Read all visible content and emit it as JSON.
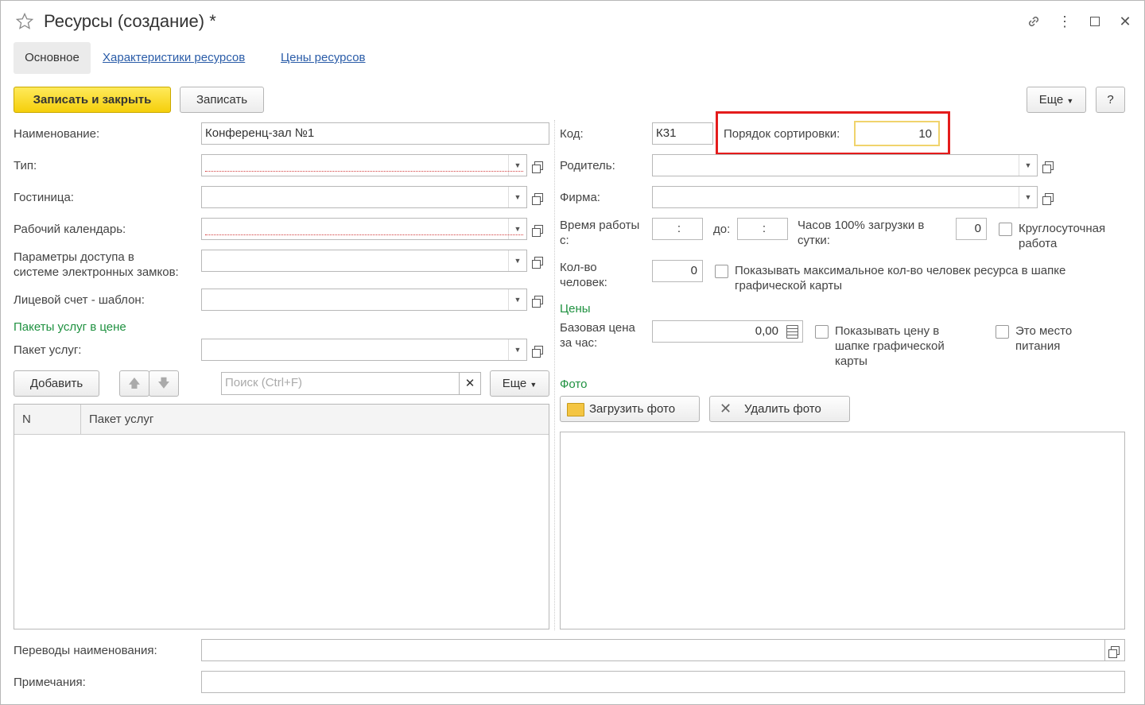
{
  "window": {
    "title": "Ресурсы (создание) *"
  },
  "tabs": [
    {
      "label": "Основное"
    },
    {
      "label": "Характеристики ресурсов"
    },
    {
      "label": "Цены ресурсов"
    }
  ],
  "toolbar": {
    "save_close": "Записать и закрыть",
    "save": "Записать",
    "more": "Еще",
    "help": "?"
  },
  "left": {
    "name_label": "Наименование:",
    "name_value": "Конференц-зал №1",
    "type_label": "Тип:",
    "hotel_label": "Гостиница:",
    "calendar_label": "Рабочий календарь:",
    "access_label_1": "Параметры доступа в",
    "access_label_2": "системе электронных замков:",
    "account_label": "Лицевой счет - шаблон:",
    "packages_group": "Пакеты услуг в цене",
    "package_label": "Пакет услуг:",
    "add_button": "Добавить",
    "search_placeholder": "Поиск (Ctrl+F)",
    "more": "Еще",
    "table_columns": {
      "n": "N",
      "package": "Пакет услуг"
    }
  },
  "right": {
    "code_label": "Код:",
    "code_value": "К31",
    "sort_label": "Порядок сортировки:",
    "sort_value": "10",
    "parent_label": "Родитель:",
    "firm_label": "Фирма:",
    "work_time_label_1": "Время работы",
    "work_time_label_2": "с:",
    "time_from": ":",
    "to_label": "до:",
    "time_to": ":",
    "hours_label_1": "Часов 100% загрузки в",
    "hours_label_2": "сутки:",
    "hours_value": "0",
    "roundclock_1": "Круглосуточная",
    "roundclock_2": "работа",
    "persons_label_1": "Кол-во",
    "persons_label_2": "человек:",
    "persons_value": "0",
    "show_max_1": "Показывать максимальное кол-во человек ресурса в шапке",
    "show_max_2": "графической карты",
    "prices_group": "Цены",
    "base_price_1": "Базовая цена",
    "base_price_2": "за час:",
    "base_price_value": "0,00",
    "show_price_1": "Показывать цену в",
    "show_price_2": "шапке графической",
    "show_price_3": "карты",
    "food_1": "Это место",
    "food_2": "питания",
    "photo_group": "Фото",
    "upload_photo": "Загрузить фото",
    "delete_photo": "Удалить фото"
  },
  "bottom": {
    "translations_label": "Переводы наименования:",
    "notes_label": "Примечания:"
  },
  "colors": {
    "accent_yellow": "#f5cf0b",
    "highlight_red": "#e41c1c",
    "group_green": "#1f9140",
    "link_blue": "#2a5ca8"
  }
}
